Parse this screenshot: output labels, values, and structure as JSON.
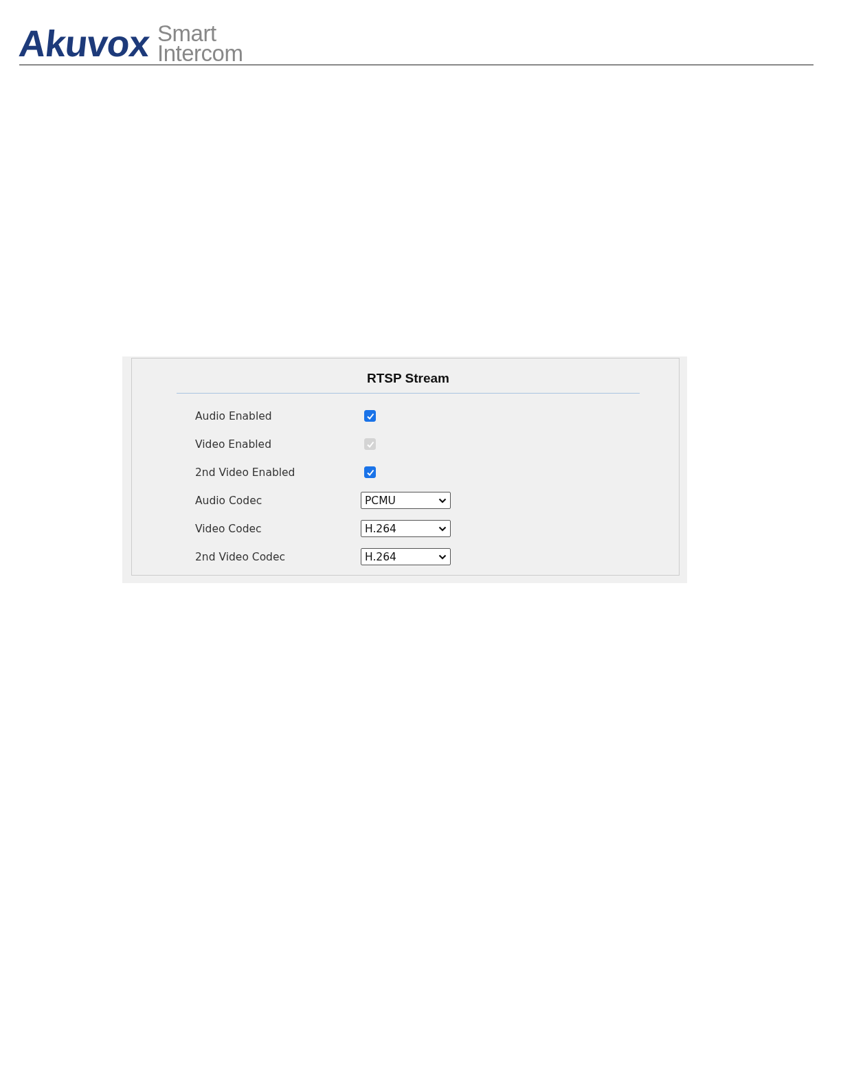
{
  "header": {
    "brand": "Akuvox",
    "tagline": [
      "Smart",
      "Intercom"
    ]
  },
  "panel": {
    "title": "RTSP Stream",
    "rows": [
      {
        "kind": "checkbox",
        "label": "Audio Enabled",
        "checked": true,
        "disabled": false
      },
      {
        "kind": "checkbox",
        "label": "Video Enabled",
        "checked": true,
        "disabled": true
      },
      {
        "kind": "checkbox",
        "label": "2nd Video Enabled",
        "checked": true,
        "disabled": false
      },
      {
        "kind": "select",
        "label": "Audio Codec",
        "value": "PCMU"
      },
      {
        "kind": "select",
        "label": "Video Codec",
        "value": "H.264"
      },
      {
        "kind": "select",
        "label": "2nd Video Codec",
        "value": "H.264"
      }
    ]
  }
}
